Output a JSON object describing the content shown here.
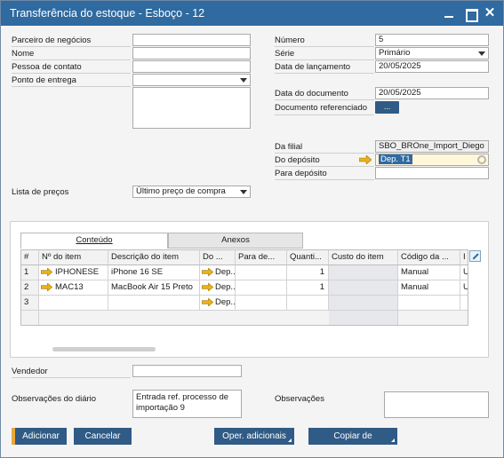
{
  "window": {
    "title": "Transferência do estoque - Esboço - 12"
  },
  "header_left": {
    "business_partner_label": "Parceiro de negócios",
    "name_label": "Nome",
    "contact_person_label": "Pessoa de contato",
    "ship_to_label": "Ponto de entrega",
    "price_list_label": "Lista de preços",
    "price_list_value": "Último preço de compra"
  },
  "header_right": {
    "number_label": "Número",
    "number_value": "5",
    "series_label": "Série",
    "series_value": "Primário",
    "posting_date_label": "Data de lançamento",
    "posting_date_value": "20/05/2025",
    "document_date_label": "Data do documento",
    "document_date_value": "20/05/2025",
    "ref_document_label": "Documento referenciado",
    "ref_document_button": "...",
    "from_branch_label": "Da filial",
    "from_branch_value": "SBO_BROne_Import_Diego",
    "from_warehouse_label": "Do depósito",
    "from_warehouse_value": "Dep. T1",
    "to_warehouse_label": "Para depósito",
    "to_warehouse_value": ""
  },
  "tabs": [
    {
      "label": "Conteúdo",
      "active": true
    },
    {
      "label": "Anexos",
      "active": false
    }
  ],
  "grid": {
    "columns": [
      "#",
      "Nº do item",
      "Descrição do item",
      "Do ...",
      "Para de...",
      "Quanti...",
      "Custo do item",
      "Código da ...",
      "I"
    ],
    "rows": [
      {
        "num": "1",
        "item": "IPHONESE",
        "desc": "iPhone 16 SE",
        "from": "Dep...",
        "to": "",
        "qty": "1",
        "cost": "",
        "code": "Manual",
        "extra": "U"
      },
      {
        "num": "2",
        "item": "MAC13",
        "desc": "MacBook Air 15 Preto",
        "from": "Dep...",
        "to": "",
        "qty": "1",
        "cost": "",
        "code": "Manual",
        "extra": "U"
      },
      {
        "num": "3",
        "item": "",
        "desc": "",
        "from": "Dep...",
        "to": "",
        "qty": "",
        "cost": "",
        "code": "",
        "extra": ""
      }
    ]
  },
  "footer": {
    "sales_employee_label": "Vendedor",
    "journal_remarks_label": "Observações do diário",
    "journal_remarks_value": "Entrada ref. processo de importação 9",
    "remarks_label": "Observações"
  },
  "buttons": {
    "add": "Adicionar",
    "cancel": "Cancelar",
    "more_operations": "Oper. adicionais",
    "copy_from": "Copiar de"
  },
  "colors": {
    "titlebar": "#2f6aa0",
    "button": "#2f5b86",
    "link_arrow": "#e9b21a",
    "primary_accent": "#e9a83a"
  },
  "icons": [
    "minimize-icon",
    "maximize-icon",
    "close-icon",
    "link-arrow-icon",
    "dropdown-icon",
    "gear-icon",
    "expand-icon"
  ]
}
